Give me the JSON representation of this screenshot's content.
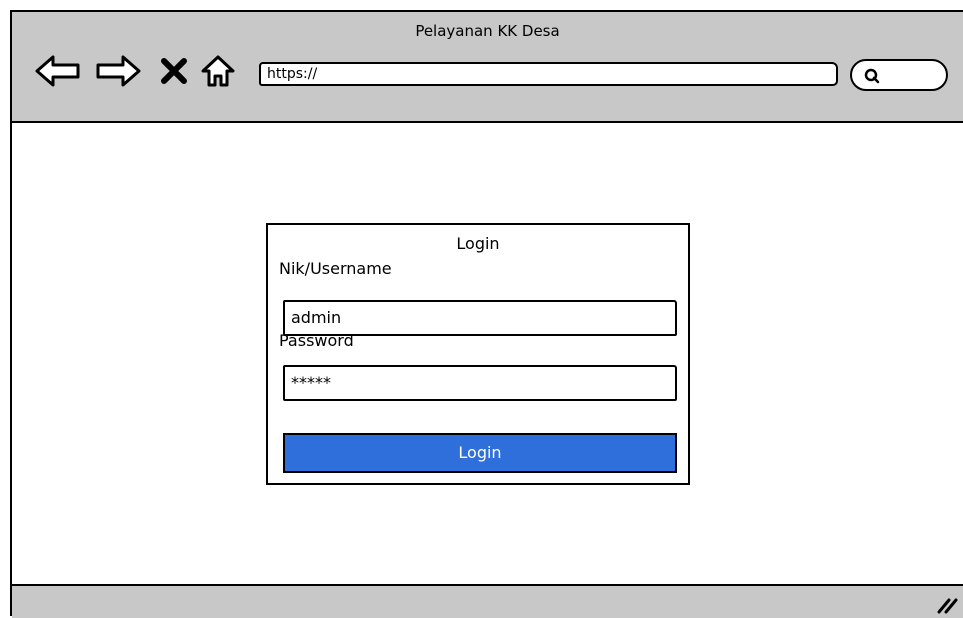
{
  "browser": {
    "title": "Pelayanan KK Desa",
    "address": "https://"
  },
  "login": {
    "title": "Login",
    "username_label": "Nik/Username",
    "username_value": "admin",
    "password_label": "Password",
    "password_value": "*****",
    "submit_label": "Login",
    "button_color": "#2f6fdc"
  },
  "icons": [
    "back-arrow-icon",
    "forward-arrow-icon",
    "close-icon",
    "home-icon",
    "search-icon",
    "resize-grip-icon"
  ]
}
